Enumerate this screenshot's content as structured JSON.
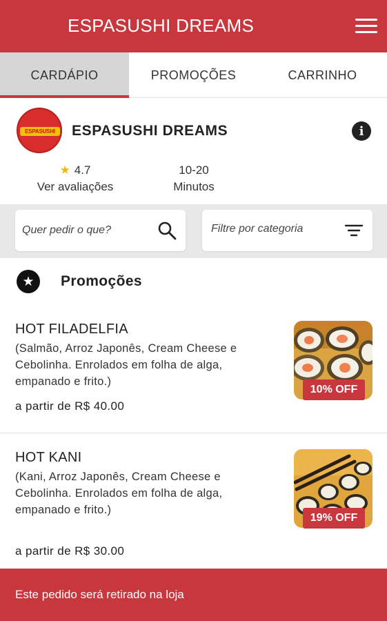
{
  "header": {
    "title": "ESPASUSHI DREAMS",
    "menu_icon": "hamburger-menu-icon"
  },
  "tabs": [
    {
      "label": "CARDÁPIO",
      "active": true
    },
    {
      "label": "PROMOÇÕES",
      "active": false
    },
    {
      "label": "CARRINHO",
      "active": false
    }
  ],
  "store": {
    "name": "ESPASUSHI DREAMS",
    "logo_text": "ESPASUSHI",
    "rating": "4.7",
    "rating_label": "Ver avaliações",
    "delivery_time": "10-20",
    "delivery_unit": "Minutos"
  },
  "search": {
    "placeholder": "Quer pedir o que?"
  },
  "filter": {
    "placeholder": "Filtre por categoria"
  },
  "section": {
    "title": "Promoções"
  },
  "items": [
    {
      "name": "HOT FILADELFIA",
      "description": "(Salmão, Arroz Japonês, Cream Cheese e Cebolinha. Enrolados em folha de alga, empanado e frito.)",
      "price": "a partir de R$ 40.00",
      "discount": "10% OFF"
    },
    {
      "name": "HOT KANI",
      "description": "(Kani, Arroz Japonês, Cream Cheese e Cebolinha. Enrolados em folha de alga, empanado e frito.)",
      "price": "a partir de R$ 30.00",
      "discount": "19% OFF"
    }
  ],
  "footer": {
    "text": "Este pedido será retirado na loja"
  },
  "colors": {
    "brand_red": "#c8373d",
    "tab_active_bg": "#d6d6d6",
    "search_area_bg": "#e8e8e8",
    "star": "#f2b705"
  }
}
